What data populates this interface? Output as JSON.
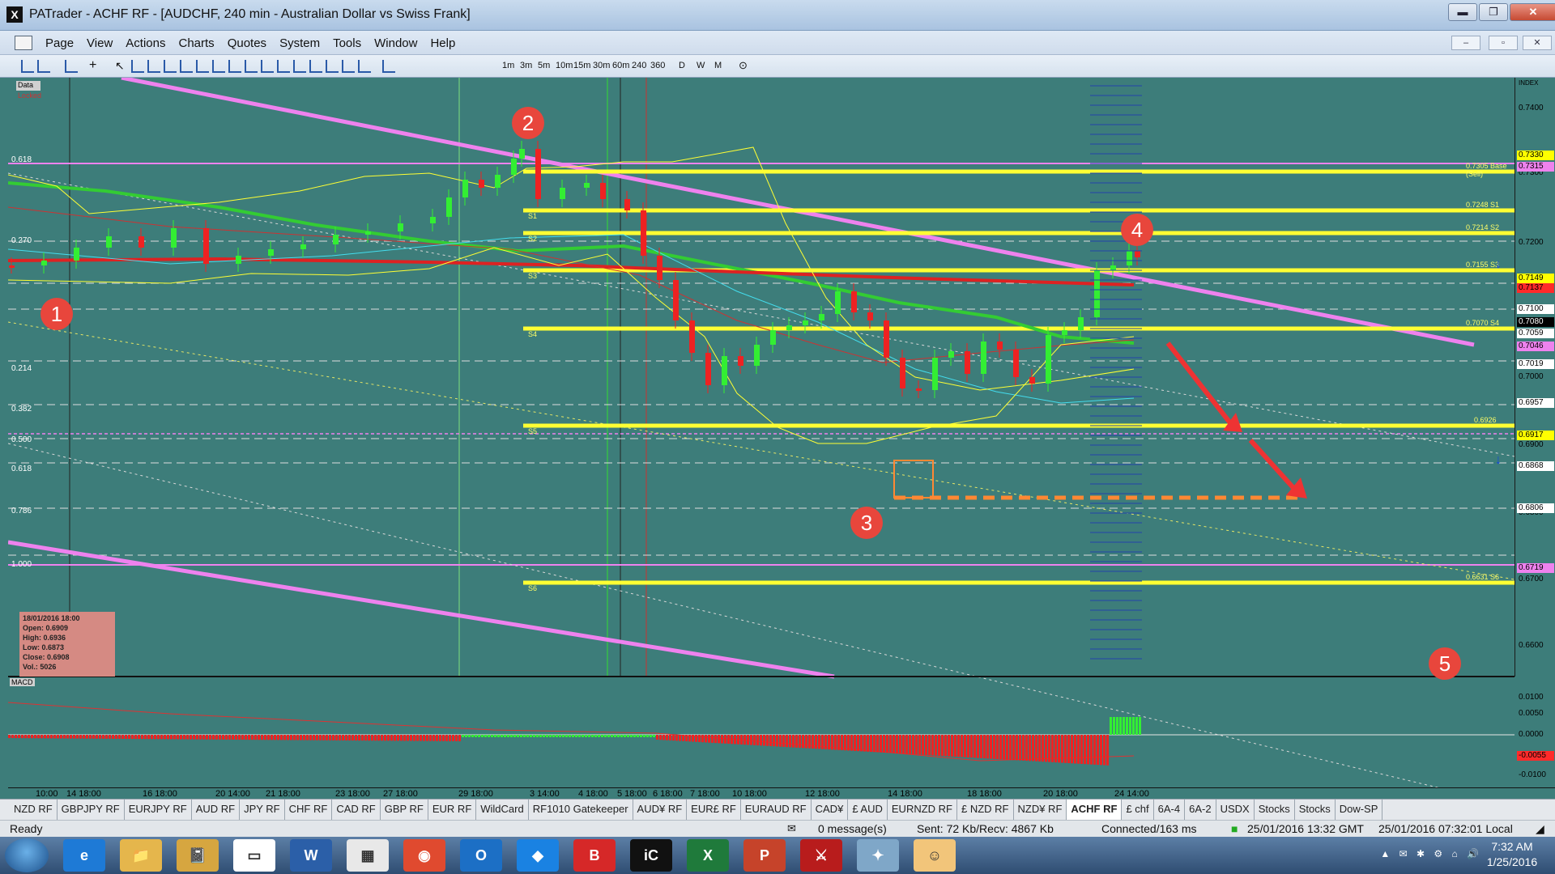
{
  "window": {
    "title": "PATrader - ACHF RF - [AUDCHF, 240 min - Australian Dollar vs Swiss Frank]",
    "app_icon_glyph": "X",
    "minimize": "▬",
    "maximize": "❐",
    "close": "✕"
  },
  "menu": {
    "items": [
      "Page",
      "View",
      "Actions",
      "Charts",
      "Quotes",
      "System",
      "Tools",
      "Window",
      "Help"
    ]
  },
  "toolbar": {
    "timeframes": [
      "1m",
      "3m",
      "5m",
      "10m",
      "15m",
      "30m",
      "60m",
      "240",
      "360",
      "D",
      "W",
      "M"
    ]
  },
  "chart": {
    "data_label": "Data",
    "locked_label": "Locked",
    "index_label": "INDEX",
    "fib_labels": [
      "0.618",
      "0.270",
      "0.214",
      "0.382",
      "0.500",
      "0.618",
      "0.786",
      "1.000"
    ],
    "level_labels": [
      "S1",
      "S2",
      "S3",
      "S4",
      "S5",
      "S6"
    ],
    "price_labels": [
      "0.7400",
      "0.7300",
      "0.7200",
      "0.7100",
      "0.7000",
      "0.6900",
      "0.6800",
      "0.6700",
      "0.6600"
    ],
    "price_badges": [
      {
        "value": "0.7330",
        "color": "#ffff00"
      },
      {
        "value": "0.7315",
        "color": "#ee82ee"
      },
      {
        "value": "0.7149",
        "color": "#ffff00"
      },
      {
        "value": "0.7137",
        "color": "#ff2a2a"
      },
      {
        "value": "0.7100",
        "color": "#ffffff"
      },
      {
        "value": "0.7080",
        "color": "#000000"
      },
      {
        "value": "0.7059",
        "color": "#ffffff"
      },
      {
        "value": "0.7046",
        "color": "#ee82ee"
      },
      {
        "value": "0.7019",
        "color": "#ffffff"
      },
      {
        "value": "0.6957",
        "color": "#ffffff"
      },
      {
        "value": "0.6917",
        "color": "#ffff00"
      },
      {
        "value": "0.6868",
        "color": "#ffffff"
      },
      {
        "value": "0.6806",
        "color": "#ffffff"
      },
      {
        "value": "0.6719",
        "color": "#ee82ee"
      }
    ],
    "line_tags": [
      "0.7305 Base (Sell)",
      "0.7248 S1",
      "0.7214 S2",
      "0.7155 S3",
      "0.7070 S4",
      "0.6926",
      "0.6631 S6"
    ],
    "ohlc": {
      "date": "18/01/2016 18:00",
      "open": "Open: 0.6909",
      "high": "High: 0.6936",
      "low": "Low: 0.6873",
      "close": "Close: 0.6908",
      "vol": "Vol.: 5026"
    },
    "markers": [
      "1",
      "2",
      "3",
      "4",
      "5"
    ],
    "macd_label": "MACD",
    "macd_scale": [
      "0.0100",
      "0.0050",
      "0.0000",
      "-0.0055",
      "-0.0100"
    ],
    "date_labels": [
      "10:00",
      "14 18:00",
      "16 18:00",
      "20 14:00",
      "21 18:00",
      "23 18:00",
      "27 18:00",
      "29 18:00",
      "3 14:00",
      "4 18:00",
      "5 18:00",
      "6 18:00",
      "7 18:00",
      "10 18:00",
      "12 18:00",
      "14 18:00",
      "18 18:00",
      "20 18:00",
      "24 14:00"
    ],
    "colors": {
      "bg": "#3d7d7a",
      "bull": "#33ee33",
      "bear": "#ee2222",
      "fib_yellow": "#ffff33",
      "trend": "#ee82ee",
      "ma_green": "#33cc33",
      "ma_red": "#dd2222"
    }
  },
  "tabs": [
    "NZD RF",
    "GBPJPY RF",
    "EURJPY RF",
    "AUD RF",
    "JPY RF",
    "CHF RF",
    "CAD RF",
    "GBP RF",
    "EUR RF",
    "WildCard",
    "RF1010 Gatekeeper",
    "AUD¥ RF",
    "EUR£ RF",
    "EURAUD RF",
    "CAD¥",
    "£ AUD",
    "EURNZD RF",
    "£ NZD RF",
    "NZD¥ RF",
    "ACHF RF",
    "£ chf",
    "6A-4",
    "6A-2",
    "USDX",
    "Stocks",
    "Stocks",
    "Dow-SP"
  ],
  "active_tab": "ACHF RF",
  "status": {
    "ready": "Ready",
    "messages": "0 message(s)",
    "sent": "Sent: 72 Kb/Recv: 4867 Kb",
    "connected": "Connected/163 ms",
    "gmt": "25/01/2016 13:32 GMT",
    "local": "25/01/2016 07:32:01 Local"
  },
  "taskbar": {
    "apps": [
      "e",
      "📁",
      "📓",
      "▭",
      "W",
      "▦",
      "◉",
      "O",
      "◆",
      "B",
      "iC",
      "X",
      "P",
      "⚔",
      "✦",
      "☺"
    ],
    "time": "7:32 AM",
    "date": "1/25/2016"
  }
}
